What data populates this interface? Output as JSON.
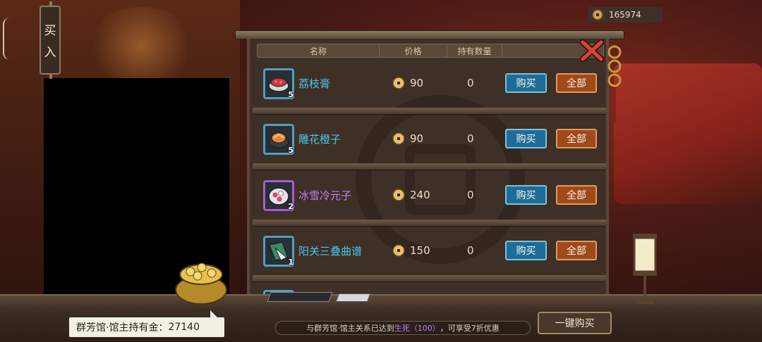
{
  "currency": {
    "amount": "165974",
    "icon": "coin-icon"
  },
  "side_tab": {
    "char1": "买",
    "char2": "入"
  },
  "table_header": {
    "name": "名称",
    "price": "价格",
    "held": "持有数量"
  },
  "items": [
    {
      "name": "荔枝膏",
      "count": "5",
      "price": "90",
      "held": "0",
      "buy_label": "购买",
      "all_label": "全部",
      "rarity": "blue",
      "icon": "lychee-paste-bowl-icon"
    },
    {
      "name": "雕花橙子",
      "count": "5",
      "price": "90",
      "held": "0",
      "buy_label": "购买",
      "all_label": "全部",
      "rarity": "blue",
      "icon": "carved-orange-bowl-icon"
    },
    {
      "name": "冰雪冷元子",
      "count": "2",
      "price": "240",
      "held": "0",
      "buy_label": "购买",
      "all_label": "全部",
      "rarity": "purple",
      "icon": "iced-dumpling-bowl-icon"
    },
    {
      "name": "阳关三叠曲谱",
      "count": "1",
      "price": "150",
      "held": "0",
      "buy_label": "购买",
      "all_label": "全部",
      "rarity": "blue",
      "icon": "music-score-icon"
    }
  ],
  "owner_gold": {
    "label": "群芳馆·馆主持有金：",
    "amount": "27140"
  },
  "notice": {
    "prefix": "与群芳馆·馆主关系已达到",
    "relation": "生死（100）",
    "suffix": "，可享受7折优惠"
  },
  "buy_all_button": "一键购买",
  "colors": {
    "buy_button": "#1f6d96",
    "all_button": "#a04a1c",
    "blue_item": "#4cc6e8",
    "purple_item": "#c080f0"
  }
}
